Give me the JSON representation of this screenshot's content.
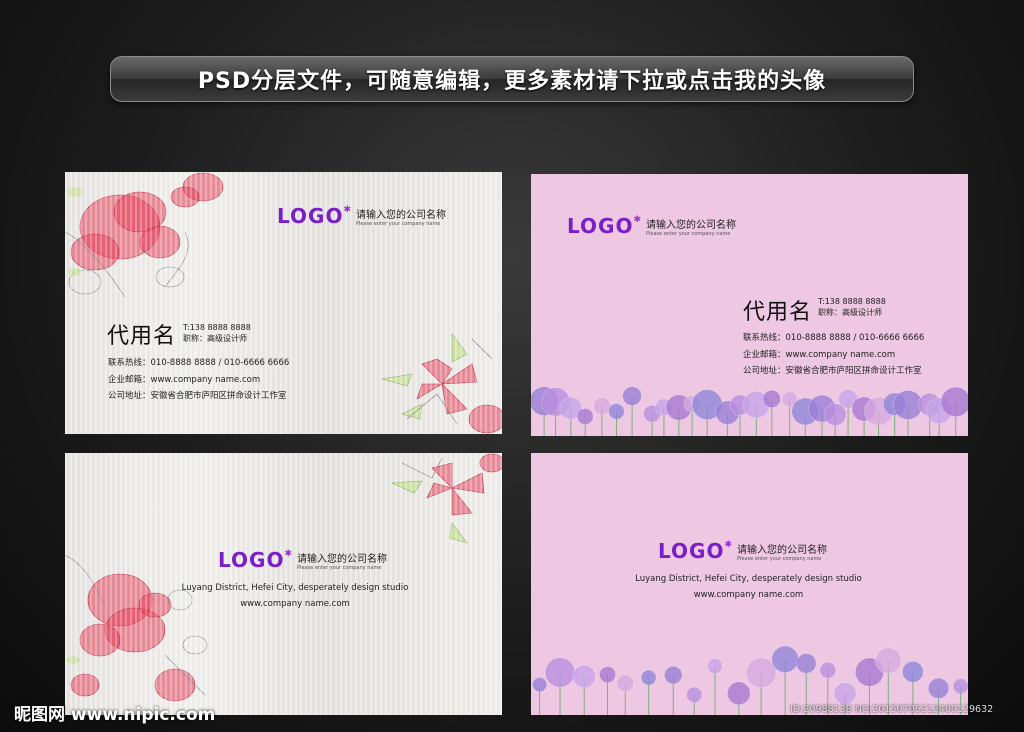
{
  "banner": {
    "text": "PSD分层文件，可随意编辑，更多素材请下拉或点击我的头像"
  },
  "logo": {
    "word": "LOGO",
    "company_cn": "请输入您的公司名称",
    "company_en": "Please enter your company name"
  },
  "person": {
    "name": "代用名",
    "tel": "T:138 8888 8888",
    "title": "职称：高级设计师"
  },
  "contact": {
    "hotline": "联系热线：010-8888 8888 / 010-6666 6666",
    "email": "企业邮箱：www.company name.com",
    "address": "公司地址：安徽省合肥市庐阳区拼命设计工作室"
  },
  "back": {
    "address_en": "Luyang District, Hefei City, desperately design studio",
    "website": "www.company name.com"
  },
  "watermark": {
    "site": "昵图网 www.nipic.com",
    "id": "ID:20988128 NO:20150705212400129632"
  },
  "colors": {
    "logo": "#7a1fc7",
    "pink_card": "#eec7e2",
    "flower_red": "#e8405a"
  }
}
